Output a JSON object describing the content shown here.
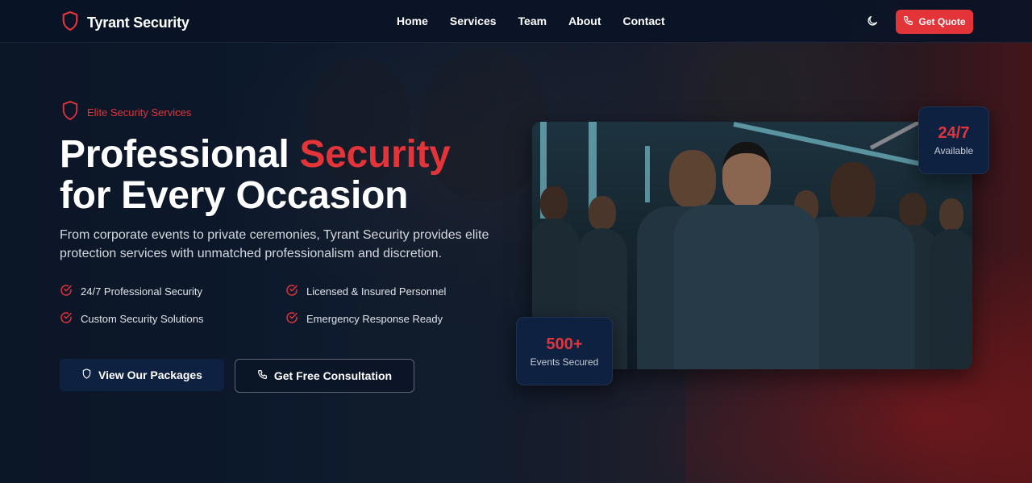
{
  "brand": {
    "name": "Tyrant Security",
    "icon": "shield-icon"
  },
  "nav": {
    "links": [
      "Home",
      "Services",
      "Team",
      "About",
      "Contact"
    ],
    "theme_icon": "moon-icon",
    "quote_button": "Get Quote",
    "quote_icon": "phone-icon"
  },
  "hero": {
    "eyebrow": "Elite Security Services",
    "headline_pre": "Professional ",
    "headline_accent": "Security",
    "headline_line2": "for Every Occasion",
    "lede": "From corporate events to private ceremonies, Tyrant Security provides elite protection services with unmatched professionalism and discretion.",
    "features": [
      "24/7 Professional Security",
      "Licensed & Insured Personnel",
      "Custom Security Solutions",
      "Emergency Response Ready"
    ],
    "primary_button": "View Our Packages",
    "secondary_button": "Get Free Consultation"
  },
  "stats": {
    "availability": {
      "value": "24/7",
      "label": "Available"
    },
    "events": {
      "value": "500+",
      "label": "Events Secured"
    }
  },
  "colors": {
    "accent": "#e3343a",
    "navy": "#0f2140",
    "background": "#0b1526"
  }
}
